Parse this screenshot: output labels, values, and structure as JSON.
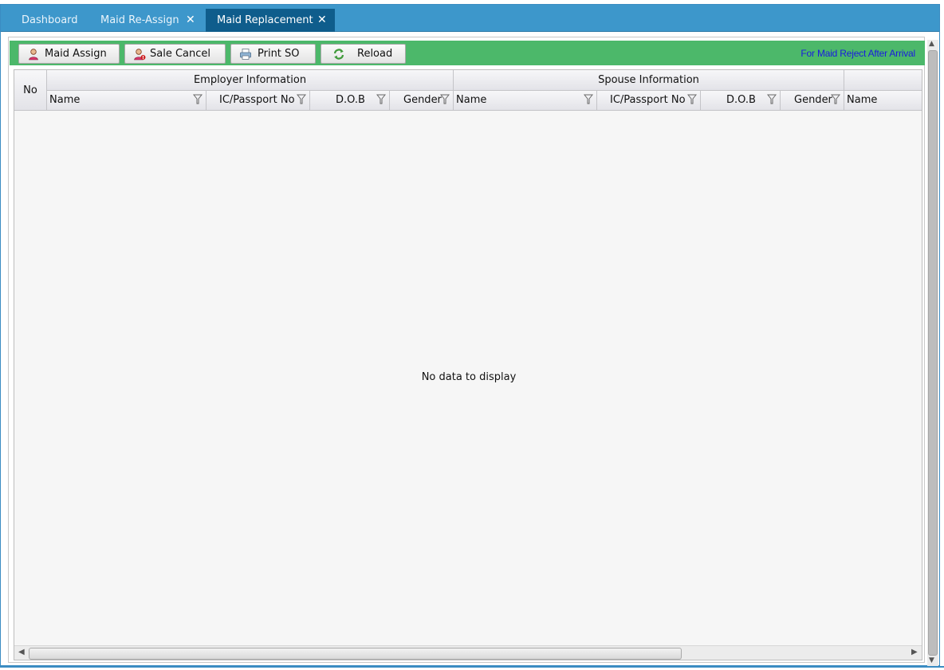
{
  "tabs": [
    {
      "label": "Dashboard",
      "closable": false,
      "active": false
    },
    {
      "label": "Maid Re-Assign",
      "closable": true,
      "active": false
    },
    {
      "label": "Maid Replacement",
      "closable": true,
      "active": true
    }
  ],
  "close_glyph": "✕",
  "toolbar": {
    "buttons": [
      {
        "label": "Maid Assign",
        "icon": "user-icon"
      },
      {
        "label": "Sale Cancel",
        "icon": "user-cancel-icon"
      },
      {
        "label": "Print SO",
        "icon": "printer-icon"
      },
      {
        "label": "Reload",
        "icon": "reload-icon"
      }
    ],
    "note": "For Maid Reject After Arrival",
    "background": "#4cb86a"
  },
  "grid": {
    "no_header": "No",
    "groups": [
      "Employer Information",
      "Spouse Information"
    ],
    "columns": [
      "Name",
      "IC/Passport No",
      "D.O.B",
      "Gender",
      "Name",
      "IC/Passport No",
      "D.O.B",
      "Gender",
      "Name"
    ],
    "empty_text": "No data to display"
  },
  "colors": {
    "tab_bar": "#3d97cb",
    "active_tab": "#0f5d8c",
    "note_text": "#1a1ae0"
  }
}
